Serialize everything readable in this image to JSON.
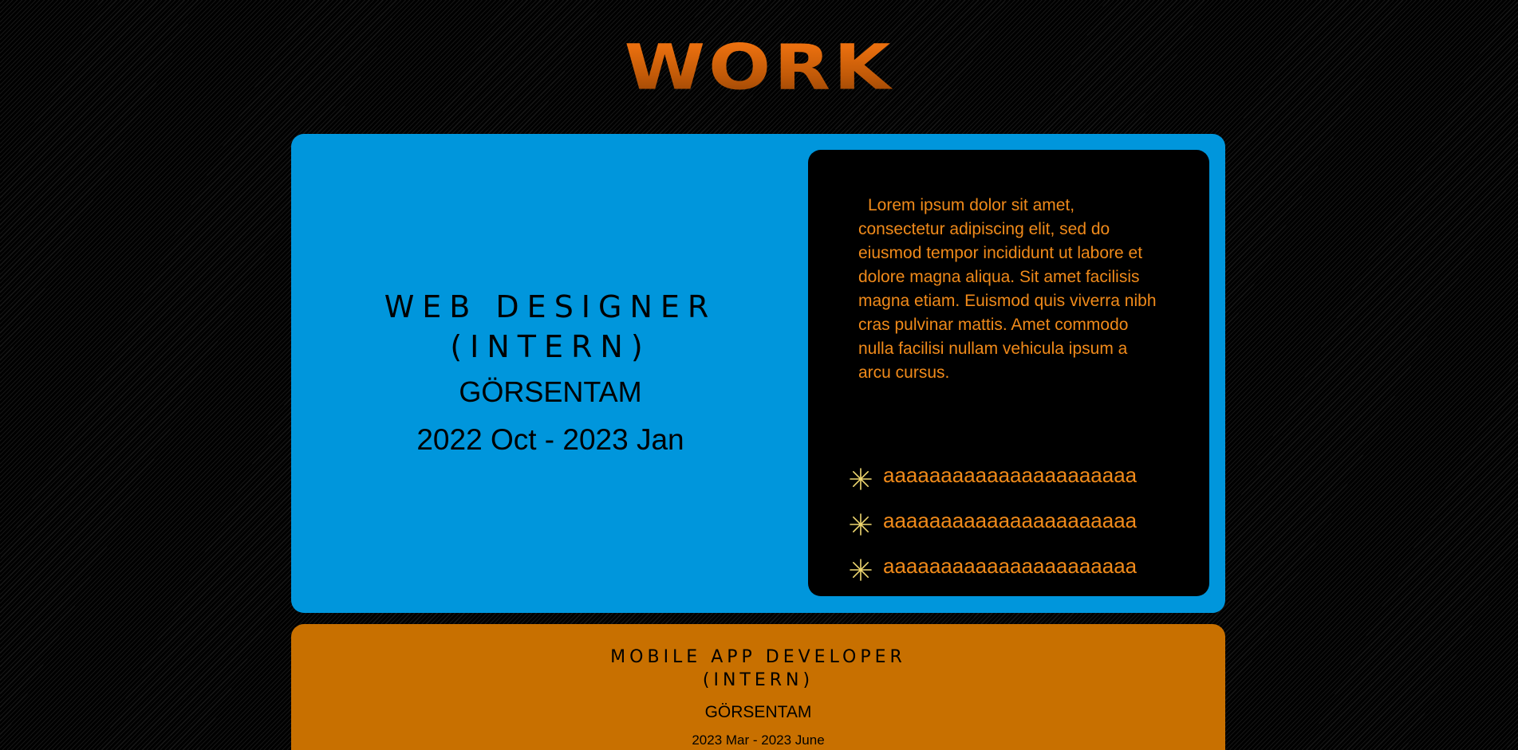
{
  "page": {
    "heading": "WORK"
  },
  "jobs": [
    {
      "title_line1": "WEB DESIGNER",
      "title_line2": "(INTERN)",
      "company": "GÖRSENTAM",
      "dates": "2022 Oct - 2023 Jan",
      "description": "Lorem ipsum dolor sit amet, consectetur adipiscing elit, sed do eiusmod tempor incididunt ut labore et dolore magna aliqua. Sit amet facilisis magna etiam. Euismod quis viverra nibh cras pulvinar mattis. Amet commodo nulla facilisi nullam vehicula ipsum a arcu cursus.",
      "bullets": [
        "aaaaaaaaaaaaaaaaaaaaaa",
        "aaaaaaaaaaaaaaaaaaaaaa",
        "aaaaaaaaaaaaaaaaaaaaaa"
      ],
      "bullet_icon": "sparkle-icon",
      "card_color": "#0096dc"
    },
    {
      "title_line1": "MOBILE APP DEVELOPER",
      "title_line2": "(INTERN)",
      "company": "GÖRSENTAM",
      "dates": "2023 Mar - 2023 June",
      "card_color": "#c87000"
    }
  ],
  "colors": {
    "heading_gradient_top": "#ff7a12",
    "heading_gradient_bottom": "#8a3d04",
    "panel_text": "#f08a1a",
    "bullet_icon": "#f0d870"
  }
}
